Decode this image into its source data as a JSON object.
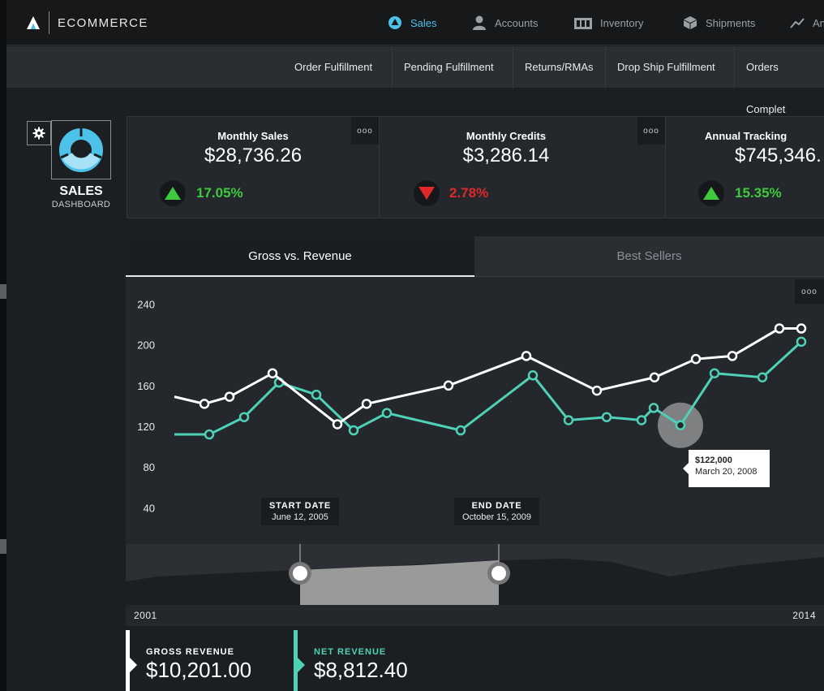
{
  "brand": {
    "name": "ECOMMERCE"
  },
  "nav": [
    {
      "label": "Sales",
      "icon": "sales-icon",
      "active": true
    },
    {
      "label": "Accounts",
      "icon": "user-icon",
      "active": false
    },
    {
      "label": "Inventory",
      "icon": "inventory-icon",
      "active": false
    },
    {
      "label": "Shipments",
      "icon": "box-icon",
      "active": false
    },
    {
      "label": "An",
      "icon": "trend-icon",
      "active": false
    }
  ],
  "subnav": [
    {
      "label": "Order Fulfillment"
    },
    {
      "label": "Pending Fulfillment"
    },
    {
      "label": "Returns/RMAs"
    },
    {
      "label": "Drop Ship Fulfillment"
    },
    {
      "label": "Orders Complet"
    }
  ],
  "dashboard": {
    "title": "SALES",
    "subtitle": "DASHBOARD"
  },
  "kpis": [
    {
      "title": "Monthly Sales",
      "value": "$28,736.26",
      "change": "17.05%",
      "direction": "up",
      "color": "#3ec93e"
    },
    {
      "title": "Monthly Credits",
      "value": "$3,286.14",
      "change": "2.78%",
      "direction": "down",
      "color": "#e0282a"
    },
    {
      "title": "Annual Tracking",
      "value": "$745,346.",
      "change": "15.35%",
      "direction": "up",
      "color": "#3ec93e"
    }
  ],
  "kpi_more": "ooo",
  "tabs": {
    "gross": "Gross vs. Revenue",
    "best": "Best Sellers"
  },
  "chart_more": "ooo",
  "chart_data": {
    "type": "line",
    "ylim": [
      20,
      250
    ],
    "yticks": [
      240,
      200,
      160,
      120,
      80,
      40
    ],
    "grid": false,
    "series": [
      {
        "color": "#ffffff",
        "values": [
          149,
          142,
          149,
          172,
          122,
          142,
          160,
          189,
          155,
          168,
          186,
          189,
          216,
          216
        ]
      },
      {
        "color": "#4fd1b8",
        "values": [
          112,
          112,
          129,
          163,
          151,
          116,
          133,
          116,
          170,
          126,
          129,
          126,
          138,
          121,
          172,
          168,
          203
        ]
      }
    ],
    "tooltip": {
      "value": "$122,000",
      "date": "March 20, 2008"
    }
  },
  "range": {
    "start_label": "START DATE",
    "start_date": "June 12, 2005",
    "end_label": "END DATE",
    "end_date": "October 15, 2009",
    "year_start": "2001",
    "year_end": "2014"
  },
  "revenue": {
    "gross_label": "GROSS REVENUE",
    "gross_value": "$10,201.00",
    "gross_color": "#ffffff",
    "net_label": "NET REVENUE",
    "net_value": "$8,812.40",
    "net_color": "#4fd1b8"
  }
}
